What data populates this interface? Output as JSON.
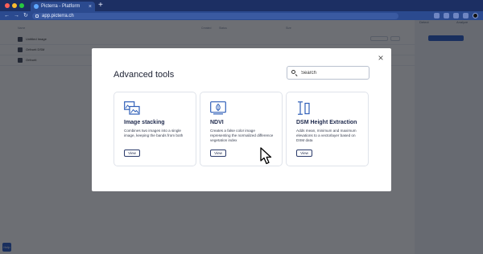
{
  "browser": {
    "tab_title": "Picterra - Platform",
    "tab_close": "×",
    "new_tab": "+",
    "url": "app.picterra.ch",
    "nav": {
      "back": "←",
      "forward": "→",
      "reload": "↻"
    }
  },
  "background": {
    "table_headers": [
      "Name",
      "Created",
      "Status",
      "Size"
    ],
    "rows": [
      {
        "name": "Untitled Image"
      },
      {
        "name": "Orthorti DSM"
      },
      {
        "name": "Orthorti"
      }
    ],
    "side_tabs": [
      "Detect",
      "Analyze"
    ],
    "help_button": "Help"
  },
  "modal": {
    "title": "Advanced tools",
    "close_label": "×",
    "search_placeholder": "Search",
    "cards": [
      {
        "icon": "image-stacking-icon",
        "title": "Image stacking",
        "description": "Combines two images into a single image, keeping the bands from both",
        "button": "View"
      },
      {
        "icon": "ndvi-icon",
        "title": "NDVI",
        "description": "Creates a false color image representing the normalized difference vegetation index",
        "button": "View"
      },
      {
        "icon": "dsm-height-icon",
        "title": "DSM Height Extraction",
        "description": "Adds mean, minimum and maximum elevations to a vectorlayer based on DSM data",
        "button": "View"
      }
    ]
  },
  "colors": {
    "browser_chrome": "#1c2f63",
    "primary_blue": "#2457c5",
    "card_title": "#1f2a4d",
    "icon_blue": "#2f5fb8"
  }
}
